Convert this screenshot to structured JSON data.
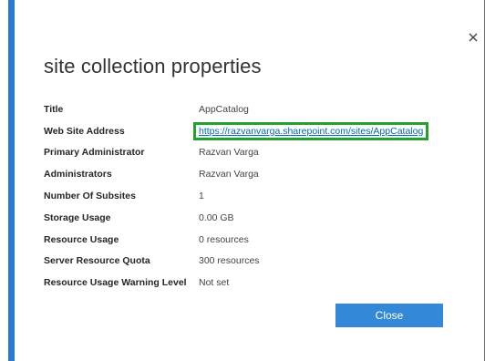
{
  "dialog": {
    "title": "site collection properties",
    "close_icon": "close-icon",
    "close_button_label": "Close",
    "accent_color": "#2a7ad1",
    "highlight_color": "#23a030"
  },
  "properties": [
    {
      "label": "Title",
      "value": "AppCatalog"
    },
    {
      "label": "Web Site Address",
      "value": "https://razvanvarga.sharepoint.com/sites/AppCatalog",
      "is_link": true,
      "highlighted": true
    },
    {
      "label": "Primary Administrator",
      "value": "Razvan Varga"
    },
    {
      "label": "Administrators",
      "value": "Razvan Varga"
    },
    {
      "label": "Number Of Subsites",
      "value": "1"
    },
    {
      "label": "Storage Usage",
      "value": "0.00 GB"
    },
    {
      "label": "Resource Usage",
      "value": "0 resources"
    },
    {
      "label": "Server Resource Quota",
      "value": "300 resources"
    },
    {
      "label": "Resource Usage Warning Level",
      "value": "Not set"
    }
  ]
}
